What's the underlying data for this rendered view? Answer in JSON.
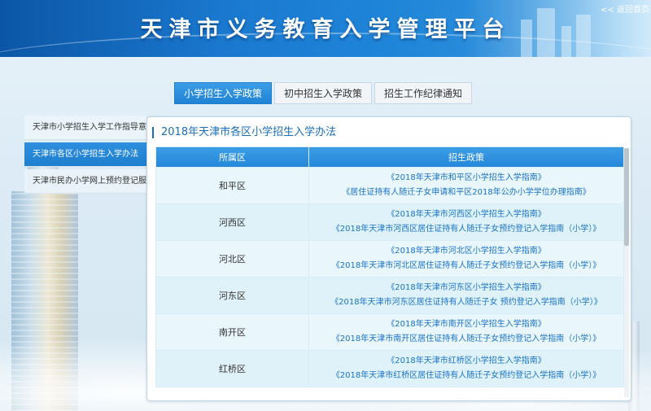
{
  "header": {
    "title": "天津市义务教育入学管理平台",
    "back_link": "<< 返回首页"
  },
  "tabs": [
    {
      "label": "小学招生入学政策",
      "active": true
    },
    {
      "label": "初中招生入学政策",
      "active": false
    },
    {
      "label": "招生工作纪律通知",
      "active": false
    }
  ],
  "sidebar": {
    "items": [
      {
        "label": "天津市小学招生入学工作指导意见",
        "active": false
      },
      {
        "label": "天津市各区小学招生入学办法",
        "active": true
      },
      {
        "label": "天津市民办小学网上预约登记服务",
        "active": false
      }
    ]
  },
  "content": {
    "title": "2018年天津市各区小学招生入学办法",
    "columns": [
      "所属区",
      "招生政策"
    ],
    "rows": [
      {
        "district": "和平区",
        "policies": [
          "《2018年天津市和平区小学招生入学指南》",
          "《居住证持有人随迁子女申请和平区2018年公办小学学位办理指南》"
        ]
      },
      {
        "district": "河西区",
        "policies": [
          "《2018年天津市河西区小学招生入学指南》",
          "《2018年天津市河西区居住证持有人随迁子女预约登记入学指南（小学）》"
        ]
      },
      {
        "district": "河北区",
        "policies": [
          "《2018年天津市河北区小学招生入学指南》",
          "《2018年天津市河北区居住证持有人随迁子女预约登记入学指南（小学）》"
        ]
      },
      {
        "district": "河东区",
        "policies": [
          "《2018年天津市河东区小学招生入学指南》",
          "《2018年天津市河东区居住证持有人随迁子女 预约登记入学指南（小学）》"
        ]
      },
      {
        "district": "南开区",
        "policies": [
          "《2018年天津市南开区小学招生入学指南》",
          "《2018年天津市南开区居住证持有人随迁子女预约登记入学指南（小学）》"
        ]
      },
      {
        "district": "红桥区",
        "policies": [
          "《2018年天津市红桥区小学招生入学指南》",
          "《2018年天津市红桥区居住证持有人随迁子女预约登记入学指南（小学）》"
        ]
      }
    ]
  }
}
